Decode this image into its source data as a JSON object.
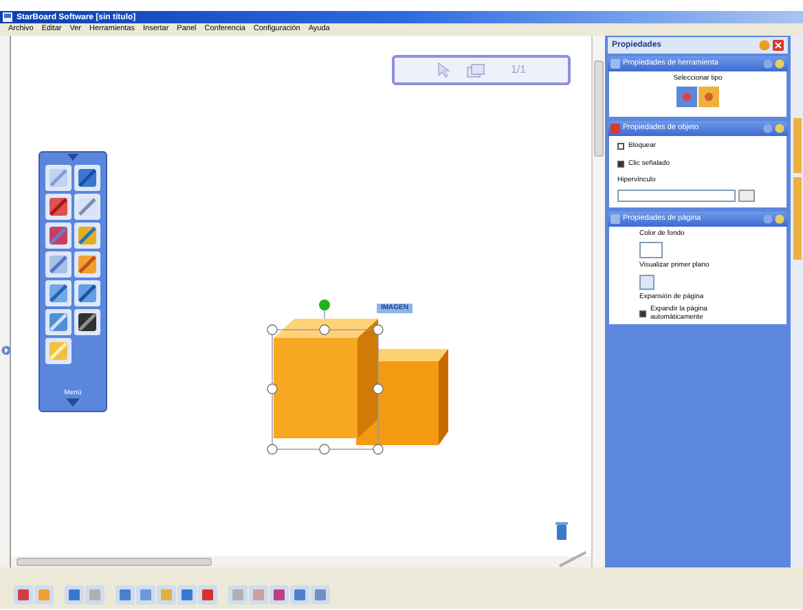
{
  "window": {
    "title": "StarBoard Software [sin título]"
  },
  "menu": [
    "Archivo",
    "Editar",
    "Ver",
    "Herramientas",
    "Insertar",
    "Panel",
    "Conferencia",
    "Configuración",
    "Ayuda"
  ],
  "page_counter": "1/1",
  "canvas": {
    "object_label": "IMAGEN",
    "palette_label": "Menú"
  },
  "properties": {
    "title": "Propiedades",
    "tool": {
      "title": "Propiedades de herramienta",
      "caption": "Seleccionar tipo"
    },
    "object": {
      "title": "Propiedades de objeto",
      "checkboxes": [
        {
          "label": "Bloquear",
          "checked": false
        },
        {
          "label": "Clic señalado",
          "checked": true
        }
      ],
      "link_label": "Hipervínculo"
    },
    "page": {
      "title": "Propiedades de página",
      "background_label": "Color de fondo",
      "foreground_label": "Visualizar primer plano",
      "expansion_label": "Expansión de página",
      "auto_expand": {
        "label": "Expandir la página automáticamente",
        "checked": true
      }
    }
  }
}
